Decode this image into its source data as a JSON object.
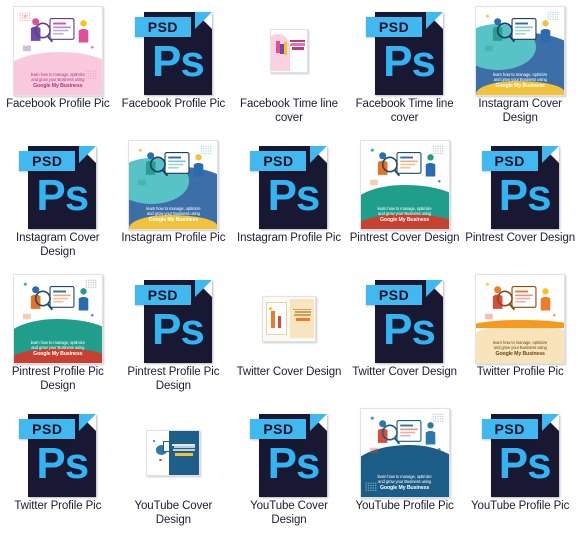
{
  "view": {
    "name": "file-explorer-icon-grid",
    "columns": 5,
    "rows": 4,
    "total_items": 20,
    "background_color": "#ffffff",
    "label_color": "#1b1b38"
  },
  "psd_icon": {
    "badge_label": "PSD",
    "glyph_label": "Ps",
    "body_color": "#181832",
    "accent_color": "#3fb9f0",
    "glyph_color": "#33b4f2"
  },
  "thumbnail_caption": {
    "line1": "learn how to manage, optimize",
    "line2": "and grow your Business using",
    "brand": "Google My Business"
  },
  "items": [
    {
      "label": "Facebook Profile Pic",
      "kind": "image",
      "thumb": "pink-large",
      "size": "lg"
    },
    {
      "label": "Facebook Profile Pic",
      "kind": "psd",
      "thumb": "psd",
      "size": "lg"
    },
    {
      "label": "Facebook Time line cover",
      "kind": "image",
      "thumb": "pink-small",
      "size": "sm"
    },
    {
      "label": "Facebook Time line cover",
      "kind": "psd",
      "thumb": "psd",
      "size": "lg"
    },
    {
      "label": "Instagram Cover Design",
      "kind": "image",
      "thumb": "teal-large",
      "size": "lg"
    },
    {
      "label": "Instagram Cover Design",
      "kind": "psd",
      "thumb": "psd",
      "size": "lg"
    },
    {
      "label": "Instagram Profile Pic",
      "kind": "image",
      "thumb": "teal-large",
      "size": "lg"
    },
    {
      "label": "Instagram Profile Pic",
      "kind": "psd",
      "thumb": "psd",
      "size": "lg"
    },
    {
      "label": "Pintrest Cover Design",
      "kind": "image",
      "thumb": "green-large",
      "size": "lg"
    },
    {
      "label": "Pintrest Cover Design",
      "kind": "psd",
      "thumb": "psd",
      "size": "lg"
    },
    {
      "label": "Pintrest Profile Pic Design",
      "kind": "image",
      "thumb": "green-large",
      "size": "lg"
    },
    {
      "label": "Pintrest Profile Pic Design",
      "kind": "psd",
      "thumb": "psd",
      "size": "lg"
    },
    {
      "label": "Twitter Cover Design",
      "kind": "image",
      "thumb": "cream-small",
      "size": "md"
    },
    {
      "label": "Twitter Cover Design",
      "kind": "psd",
      "thumb": "psd",
      "size": "lg"
    },
    {
      "label": "Twitter Profile Pic",
      "kind": "image",
      "thumb": "orange-large",
      "size": "lg"
    },
    {
      "label": "Twitter Profile Pic",
      "kind": "psd",
      "thumb": "psd",
      "size": "lg"
    },
    {
      "label": "YouTube Cover Design",
      "kind": "image",
      "thumb": "navy-small",
      "size": "md"
    },
    {
      "label": "YouTube Cover Design",
      "kind": "psd",
      "thumb": "psd",
      "size": "lg"
    },
    {
      "label": "YouTube Profile Pic",
      "kind": "image",
      "thumb": "navy-large",
      "size": "lg"
    },
    {
      "label": "YouTube Profile Pic",
      "kind": "psd",
      "thumb": "psd",
      "size": "lg"
    }
  ]
}
